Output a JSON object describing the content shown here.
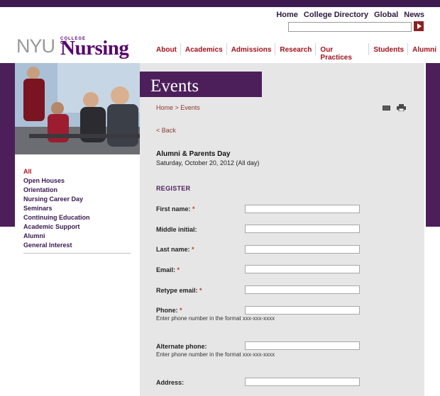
{
  "utility_nav": [
    "Home",
    "College Directory",
    "Global",
    "News"
  ],
  "search": {
    "placeholder": ""
  },
  "logo": {
    "nyu": "NYU",
    "college_of": "COLLEGE OF",
    "nursing": "Nursing"
  },
  "main_nav": [
    "About",
    "Academics",
    "Admissions",
    "Research",
    "Our Practices",
    "Students",
    "Alumni"
  ],
  "page_title": "Events",
  "breadcrumb": "Home > Events",
  "back_link": "< Back",
  "event": {
    "name": "Alumni & Parents Day",
    "date": "Saturday, October 20, 2012 (All day)"
  },
  "register_heading": "REGISTER",
  "form": {
    "first_name": "First name:",
    "middle_initial": "Middle initial:",
    "last_name": "Last name:",
    "email": "Email:",
    "retype_email": "Retype email:",
    "phone": "Phone:",
    "phone_hint": "Enter phone number in the format xxx-xxx-xxxx",
    "alt_phone": "Alternate phone:",
    "alt_phone_hint": "Enter phone number in the format xxx-xxx-xxxx",
    "address": "Address:",
    "required_mark": "*"
  },
  "side_nav": [
    "All",
    "Open Houses",
    "Orientation",
    "Nursing Career Day",
    "Seminars",
    "Continuing Education",
    "Academic Support",
    "Alumni",
    "General Interest"
  ],
  "colors": {
    "purple": "#4c1f5a",
    "brand_purple": "#57066e",
    "nav_red": "#a0111b",
    "active_red": "#b3121d",
    "link_brown": "#8b3a2f",
    "panel_gray": "#e6e6e6"
  },
  "icons": [
    "search-submit-icon",
    "mail-icon",
    "print-icon"
  ]
}
